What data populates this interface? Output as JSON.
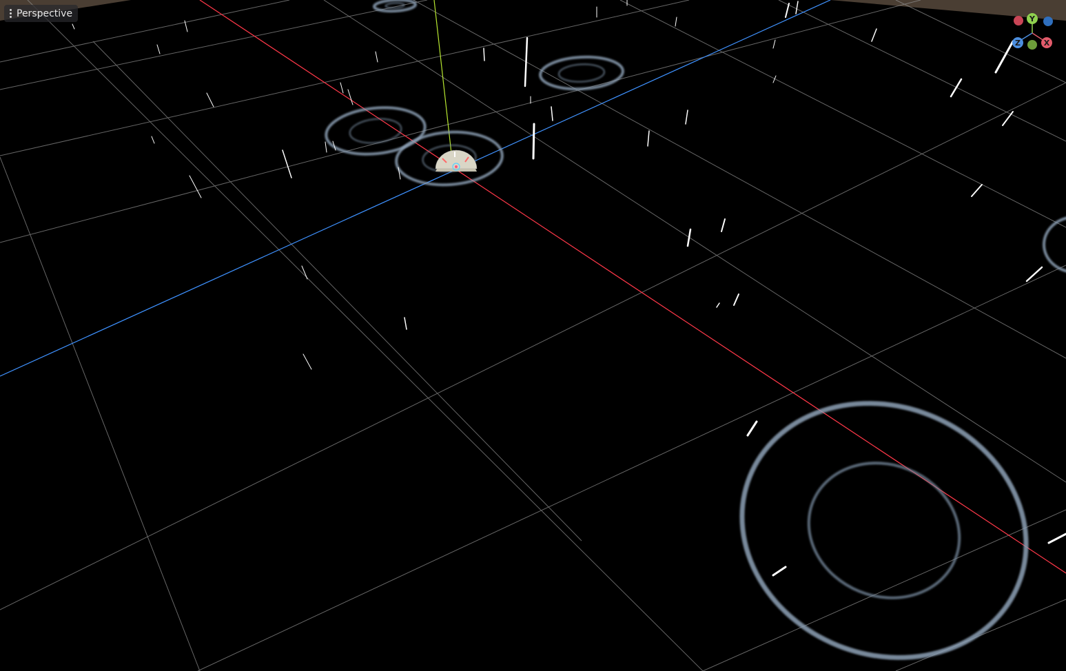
{
  "viewport": {
    "menu_icon": "kebab-menu-icon",
    "view_label": "Perspective"
  },
  "gizmo": {
    "axes": [
      {
        "key": "y",
        "label": "Y",
        "color": "#8fd14f"
      },
      {
        "key": "x",
        "label": "X",
        "color": "#e35b6b"
      },
      {
        "key": "z",
        "label": "Z",
        "color": "#4c8fe0"
      }
    ]
  },
  "scene": {
    "background": "#000000",
    "ground_color": "#4a3e33",
    "grid_color": "#8a8a8a",
    "axis_x_color": "#ff3344",
    "axis_z_color": "#3a8fff",
    "axis_y_color": "#b8e830",
    "ring_color": "#8ea2b7",
    "rain_color": "#ffffff",
    "emitter_icon": "particle-emitter-icon"
  }
}
